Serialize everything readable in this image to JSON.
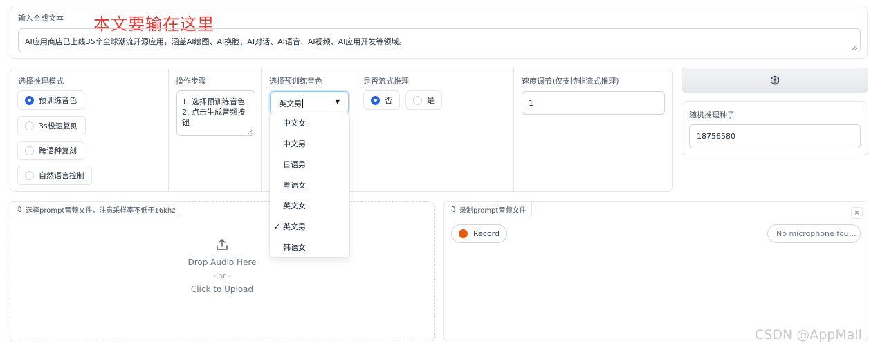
{
  "text_panel": {
    "label": "输入合成文本",
    "annotation": "本文要输在这里",
    "value": "AI应用商店已上线35个全球潮流开源应用，涵盖AI绘图、AI换脸、AI对话、AI语音、AI视频、AI应用开发等领域。"
  },
  "mode": {
    "label": "选择推理模式",
    "options": [
      "预训练音色",
      "3s极速复刻",
      "跨语种复刻",
      "自然语言控制"
    ],
    "selected": "预训练音色"
  },
  "steps": {
    "label": "操作步骤",
    "lines": [
      "1. 选择预训练音色",
      "2. 点击生成音频按",
      "钮"
    ]
  },
  "voice": {
    "label": "选择预训练音色",
    "value": "英文男",
    "options": [
      "中文女",
      "中文男",
      "日语男",
      "粤语女",
      "英文女",
      "英文男",
      "韩语女"
    ],
    "checked_mark": "✓"
  },
  "stream": {
    "label": "是否流式推理",
    "options": [
      "否",
      "是"
    ],
    "selected": "否"
  },
  "speed": {
    "label": "速度调节(仅支持非流式推理)",
    "value": "1"
  },
  "seed": {
    "dice_icon": "dice-icon",
    "label": "随机推理种子",
    "value": "18756580"
  },
  "upload": {
    "tag_icon": "music-note-icon",
    "tag": "选择prompt音频文件，注意采样率不低于16khz",
    "drop_text": "Drop Audio Here",
    "or_text": "- or -",
    "click_text": "Click to Upload"
  },
  "record": {
    "tag_icon": "music-note-icon",
    "tag": "录制prompt音频文件",
    "close": "×",
    "button": "Record",
    "mic": "No microphone fou…"
  },
  "watermark": "CSDN @AppMall",
  "colors": {
    "accent": "#2563eb",
    "record_dot": "#ea580c",
    "annotation": "#e53935"
  }
}
